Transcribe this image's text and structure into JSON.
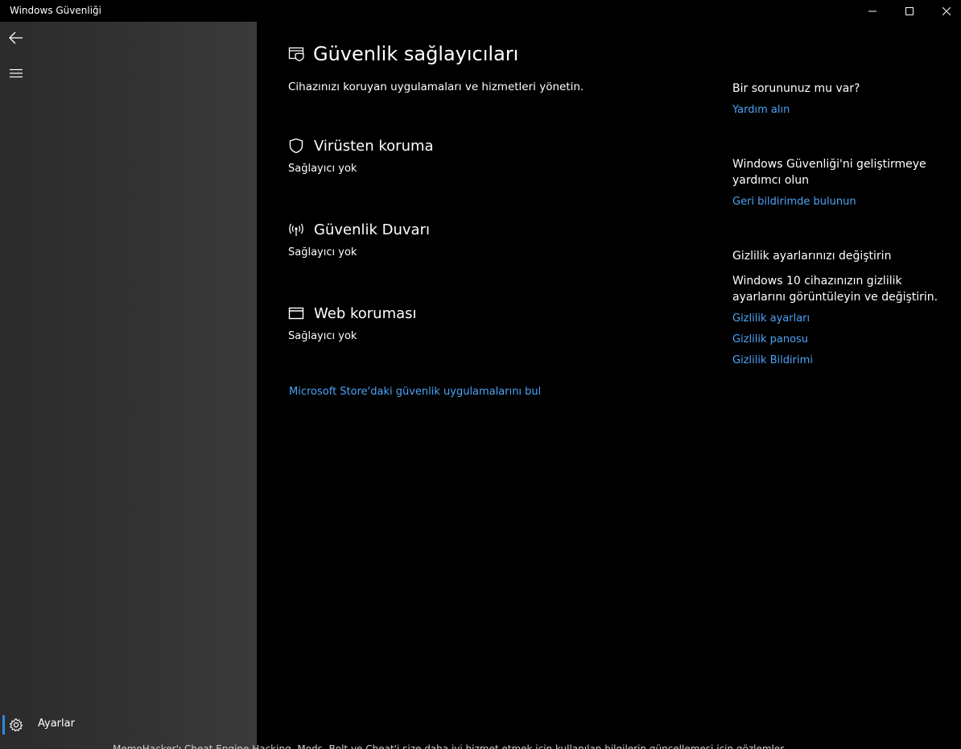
{
  "window": {
    "title": "Windows Güvenliği"
  },
  "colors": {
    "accent": "#2e8be0",
    "link": "#4ca3f5",
    "background": "#000000",
    "sidebar": "#333333"
  },
  "sidebar": {
    "back_icon": "back-arrow-icon",
    "menu_icon": "hamburger-icon",
    "settings": {
      "icon": "gear-icon",
      "label": "Ayarlar"
    }
  },
  "main": {
    "title": "Güvenlik sağlayıcıları",
    "subtitle": "Cihazınızı koruyan uygulamaları ve hizmetleri yönetin.",
    "sections": [
      {
        "icon": "shield-icon",
        "title": "Virüsten koruma",
        "status": "Sağlayıcı yok"
      },
      {
        "icon": "firewall-icon",
        "title": "Güvenlik Duvarı",
        "status": "Sağlayıcı yok"
      },
      {
        "icon": "browser-window-icon",
        "title": "Web koruması",
        "status": "Sağlayıcı yok"
      }
    ],
    "store_link": "Microsoft Store'daki güvenlik uygulamalarını bul"
  },
  "aside": {
    "help": {
      "heading": "Bir sorununuz mu var?",
      "link": "Yardım alın"
    },
    "feedback": {
      "heading": "Windows Güvenliği'ni geliştirmeye yardımcı olun",
      "link": "Geri bildirimde bulunun"
    },
    "privacy": {
      "heading": "Gizlilik ayarlarınızı değiştirin",
      "text": "Windows 10 cihazınızın gizlilik ayarlarını görüntüleyin ve değiştirin.",
      "links": [
        "Gizlilik ayarları",
        "Gizlilik panosu",
        "Gizlilik Bildirimi"
      ]
    }
  },
  "bottom_strip": "MemoHacker'ı Cheat Engine Hacking, Mods, Bolt ve Cheat'i size daha iyi hizmet etmek için kullanılan bilgilerin güncellemesi için gözlemler"
}
